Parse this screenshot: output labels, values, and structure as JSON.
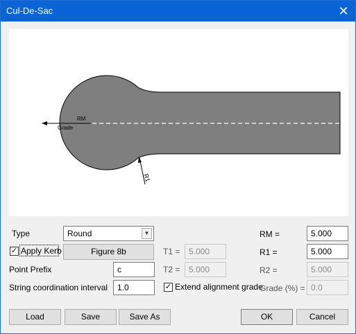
{
  "window": {
    "title": "Cul-De-Sac"
  },
  "preview": {
    "label_rm": "RM",
    "label_grade": "Grade",
    "label_r1": "R1"
  },
  "form": {
    "type_label": "Type",
    "type_value": "Round",
    "apply_kerb_label": "Apply Kerb",
    "apply_kerb_checked": true,
    "figure_button": "Figure 8b",
    "point_prefix_label": "Point Prefix",
    "point_prefix_value": "c",
    "string_interval_label": "String coordination interval",
    "string_interval_value": "1.0",
    "t1_label": "T1 =",
    "t1_value": "5.000",
    "t2_label": "T2 =",
    "t2_value": "5.000",
    "extend_label": "Extend alignment grade",
    "extend_checked": true,
    "rm_label": "RM =",
    "rm_value": "5.000",
    "r1_label": "R1 =",
    "r1_value": "5.000",
    "r2_label": "R2 =",
    "r2_value": "5.000",
    "grade_label": "Grade (%) =",
    "grade_value": "0.0"
  },
  "buttons": {
    "load": "Load",
    "save": "Save",
    "save_as": "Save As",
    "ok": "OK",
    "cancel": "Cancel"
  },
  "icons": {
    "close": "close-icon",
    "dropdown": "chevron-down-icon",
    "check": "checkmark-icon"
  },
  "colors": {
    "titlebar": "#0a64d6",
    "shape_fill": "#7f7f7f"
  }
}
